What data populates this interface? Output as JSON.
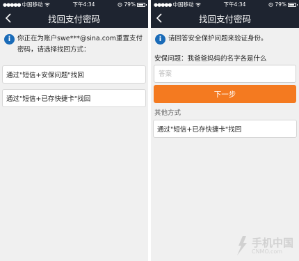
{
  "status_bar": {
    "carrier": "中国移动",
    "time": "下午4:34",
    "battery": "79%"
  },
  "left_screen": {
    "title": "找回支付密码",
    "info_text": "你正在为账户swe***@sina.com重置支付密码，请选择找回方式：",
    "options": [
      {
        "label": "通过\"短信+安保问题\"找回"
      },
      {
        "label": "通过\"短信+已存快捷卡\"找回"
      }
    ]
  },
  "right_screen": {
    "title": "找回支付密码",
    "info_text": "请回答安全保护问题来验证身份。",
    "question": "安保问题：我爸爸妈妈的名字各是什么",
    "answer_placeholder": "答案",
    "next_label": "下一步",
    "other_methods_label": "其他方式",
    "other_option": "通过\"短信+已存快捷卡\"找回"
  },
  "watermark": {
    "brand": "手机中国",
    "sub": "CNMO.com"
  },
  "colors": {
    "nav_bg": "#1e2430",
    "info_icon": "#1a6bb8",
    "next_button": "#f47a20",
    "page_bg": "#f0f0f0"
  }
}
